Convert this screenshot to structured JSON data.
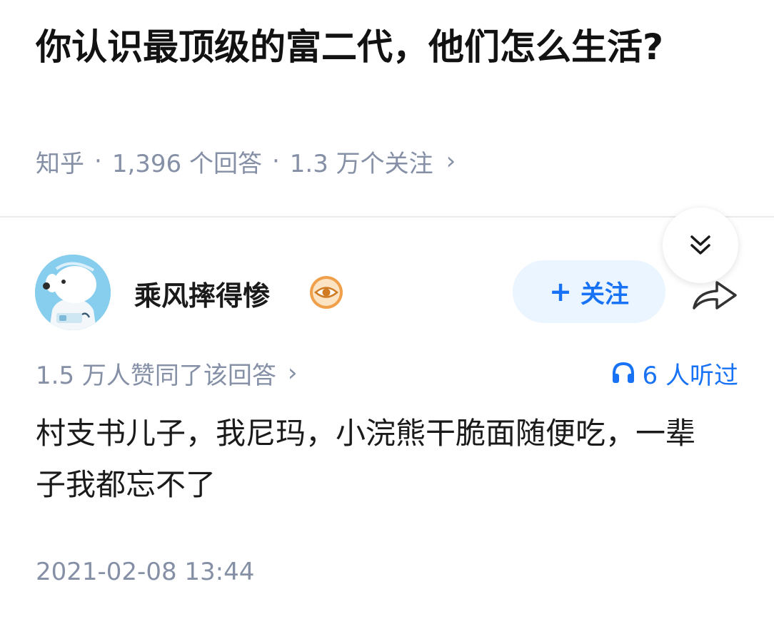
{
  "question": {
    "title": "你认识最顶级的富二代，他们怎么生活?",
    "source": "知乎",
    "answer_count": "1,396 个回答",
    "follower_count": "1.3 万个关注",
    "separator": "·",
    "chevron": "›"
  },
  "float_button": {
    "icon": "double-chevron-down-icon"
  },
  "author": {
    "name": "乘风摔得惨",
    "avatar_icon": "astronaut-dog-avatar",
    "badge_icon": "eye-badge-icon",
    "follow_label": "关注",
    "follow_plus": "+",
    "share_icon": "share-arrow-icon"
  },
  "answer": {
    "votes": "1.5 万人赞同了该回答",
    "votes_chevron": "›",
    "listen_label": "6 人听过",
    "listen_icon": "headphones-icon",
    "content": "村支书儿子，我尼玛，小浣熊干脆面随便吃，一辈子我都忘不了",
    "timestamp": "2021-02-08 13:44"
  },
  "colors": {
    "accent": "#1772f6",
    "follow_bg": "#ebf5ff",
    "meta_gray": "#8590a6",
    "badge_orange": "#f0a04b"
  }
}
